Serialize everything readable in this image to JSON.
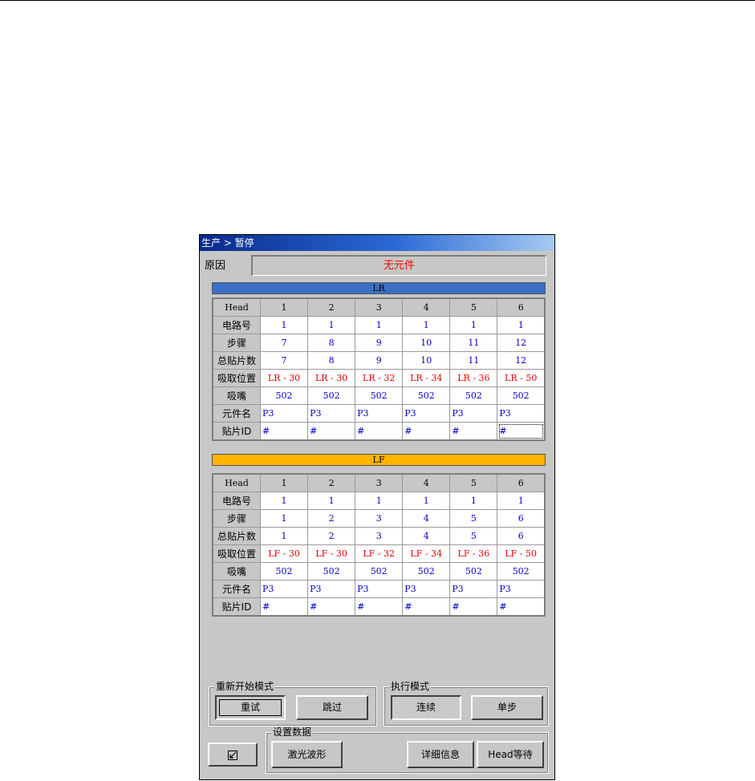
{
  "window": {
    "title": "生产 > 暂停"
  },
  "reason": {
    "label": "原因",
    "value": "无元件"
  },
  "lr": {
    "band": "LR",
    "header": [
      "Head",
      "1",
      "2",
      "3",
      "4",
      "5",
      "6"
    ],
    "rows": [
      [
        "电路号",
        "1",
        "1",
        "1",
        "1",
        "1",
        "1"
      ],
      [
        "步骤",
        "7",
        "8",
        "9",
        "10",
        "11",
        "12"
      ],
      [
        "总贴片数",
        "7",
        "8",
        "9",
        "10",
        "11",
        "12"
      ],
      [
        "吸取位置",
        "LR - 30",
        "LR - 30",
        "LR - 32",
        "LR - 34",
        "LR - 36",
        "LR - 50"
      ],
      [
        "吸嘴",
        "502",
        "502",
        "502",
        "502",
        "502",
        "502"
      ],
      [
        "元件名",
        "P3",
        "P3",
        "P3",
        "P3",
        "P3",
        "P3"
      ],
      [
        "贴片ID",
        "#",
        "#",
        "#",
        "#",
        "#",
        "#"
      ]
    ]
  },
  "lf": {
    "band": "LF",
    "header": [
      "Head",
      "1",
      "2",
      "3",
      "4",
      "5",
      "6"
    ],
    "rows": [
      [
        "电路号",
        "1",
        "1",
        "1",
        "1",
        "1",
        "1"
      ],
      [
        "步骤",
        "1",
        "2",
        "3",
        "4",
        "5",
        "6"
      ],
      [
        "总贴片数",
        "1",
        "2",
        "3",
        "4",
        "5",
        "6"
      ],
      [
        "吸取位置",
        "LF - 30",
        "LF - 30",
        "LF - 32",
        "LF - 34",
        "LF - 36",
        "LF - 50"
      ],
      [
        "吸嘴",
        "502",
        "502",
        "502",
        "502",
        "502",
        "502"
      ],
      [
        "元件名",
        "P3",
        "P3",
        "P3",
        "P3",
        "P3",
        "P3"
      ],
      [
        "贴片ID",
        "#",
        "#",
        "#",
        "#",
        "#",
        "#"
      ]
    ]
  },
  "restart_mode": {
    "label": "重新开始模式",
    "retry": "重试",
    "skip": "跳过"
  },
  "exec_mode": {
    "label": "执行模式",
    "continuous": "连续",
    "step": "单步"
  },
  "settings": {
    "label": "设置数据",
    "laser_wave": "激光波形",
    "details": "详细信息",
    "head_wait": "Head等待"
  },
  "icons": {
    "minimize": "resize-arrow-icon"
  },
  "colors": {
    "lr_band": "#3c6ec6",
    "lf_band": "#ffb400",
    "value_text": "#0000c8",
    "alert_text": "#e00000"
  }
}
